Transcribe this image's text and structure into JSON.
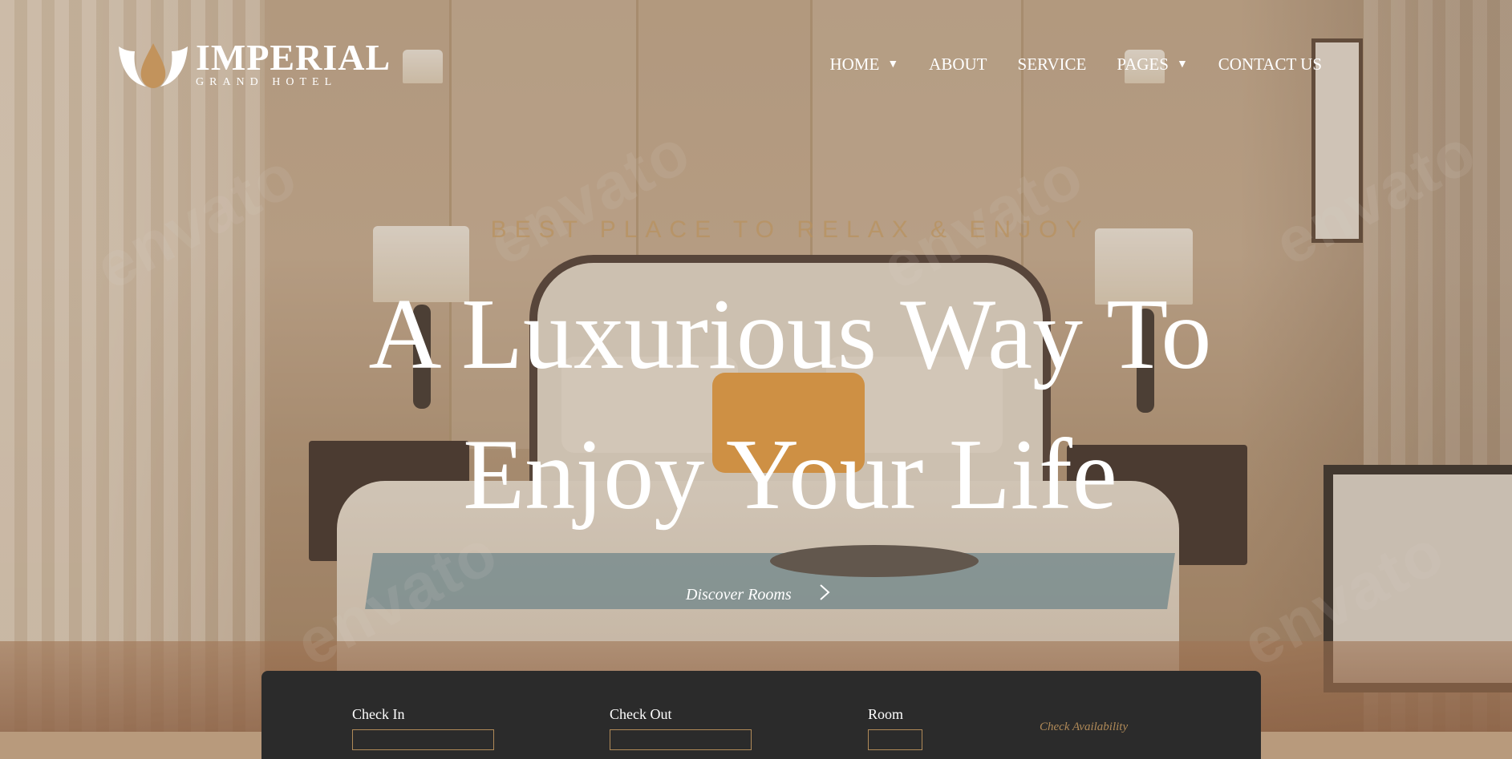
{
  "brand": {
    "name": "IMPERIAL",
    "subtitle": "GRAND HOTEL",
    "accent_color": "#c2935c"
  },
  "nav": {
    "items": [
      {
        "label": "HOME",
        "has_dropdown": true
      },
      {
        "label": "ABOUT",
        "has_dropdown": false
      },
      {
        "label": "SERVICE",
        "has_dropdown": false
      },
      {
        "label": "PAGES",
        "has_dropdown": true
      },
      {
        "label": "CONTACT US",
        "has_dropdown": false
      }
    ],
    "caret": "▼"
  },
  "hero": {
    "tagline": "BEST PLACE TO RELAX & ENJOY",
    "headline_line1": "A Luxurious Way To",
    "headline_line2": "Enjoy Your Life",
    "cta_label": "Discover Rooms",
    "cta_icon": "chevron-right-icon",
    "watermark": "envato"
  },
  "booking": {
    "check_in_label": "Check In",
    "check_out_label": "Check Out",
    "room_label": "Room",
    "availability_label": "Check Availability"
  }
}
